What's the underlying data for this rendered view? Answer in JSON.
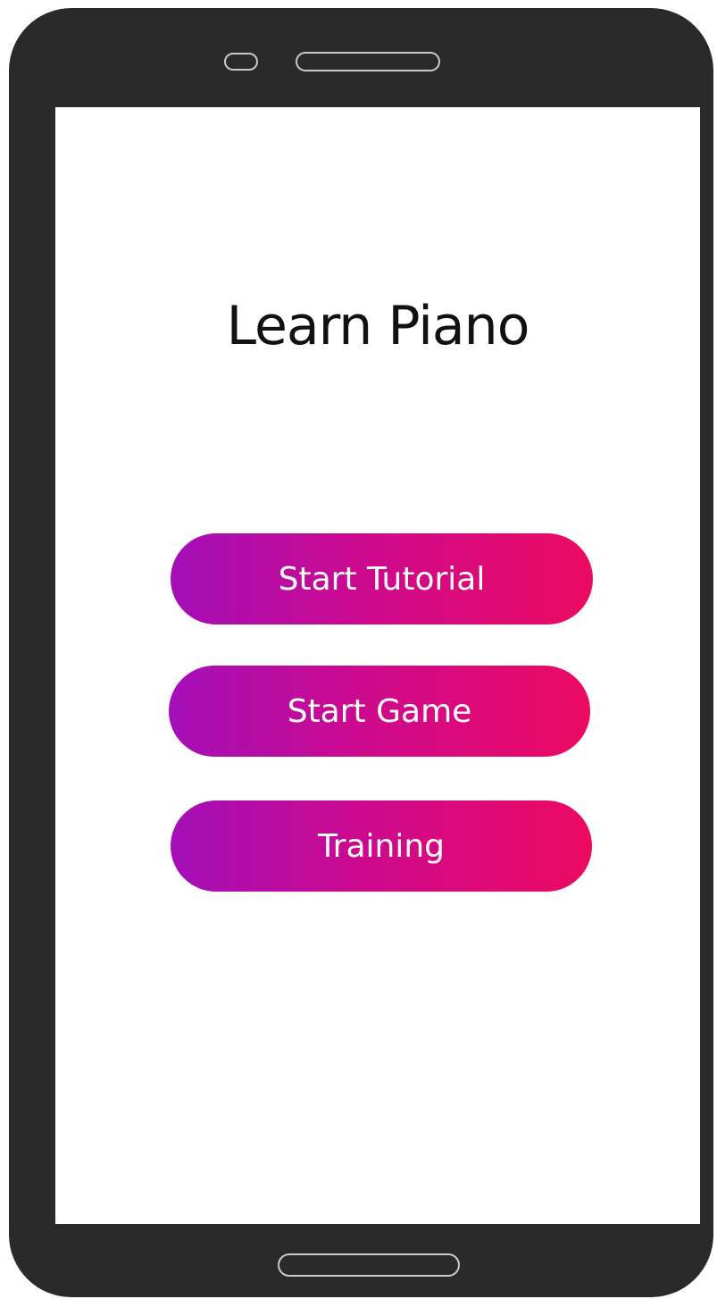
{
  "app": {
    "title": "Learn Piano"
  },
  "menu": {
    "items": [
      {
        "label": "Start Tutorial"
      },
      {
        "label": "Start Game"
      },
      {
        "label": "Training"
      }
    ]
  },
  "colors": {
    "device_frame": "#2a2a2a",
    "screen_background": "#ffffff",
    "button_gradient_start": "#a30fb8",
    "button_gradient_end": "#ec0a62",
    "button_text": "#ffffff",
    "title_text": "#111111"
  }
}
